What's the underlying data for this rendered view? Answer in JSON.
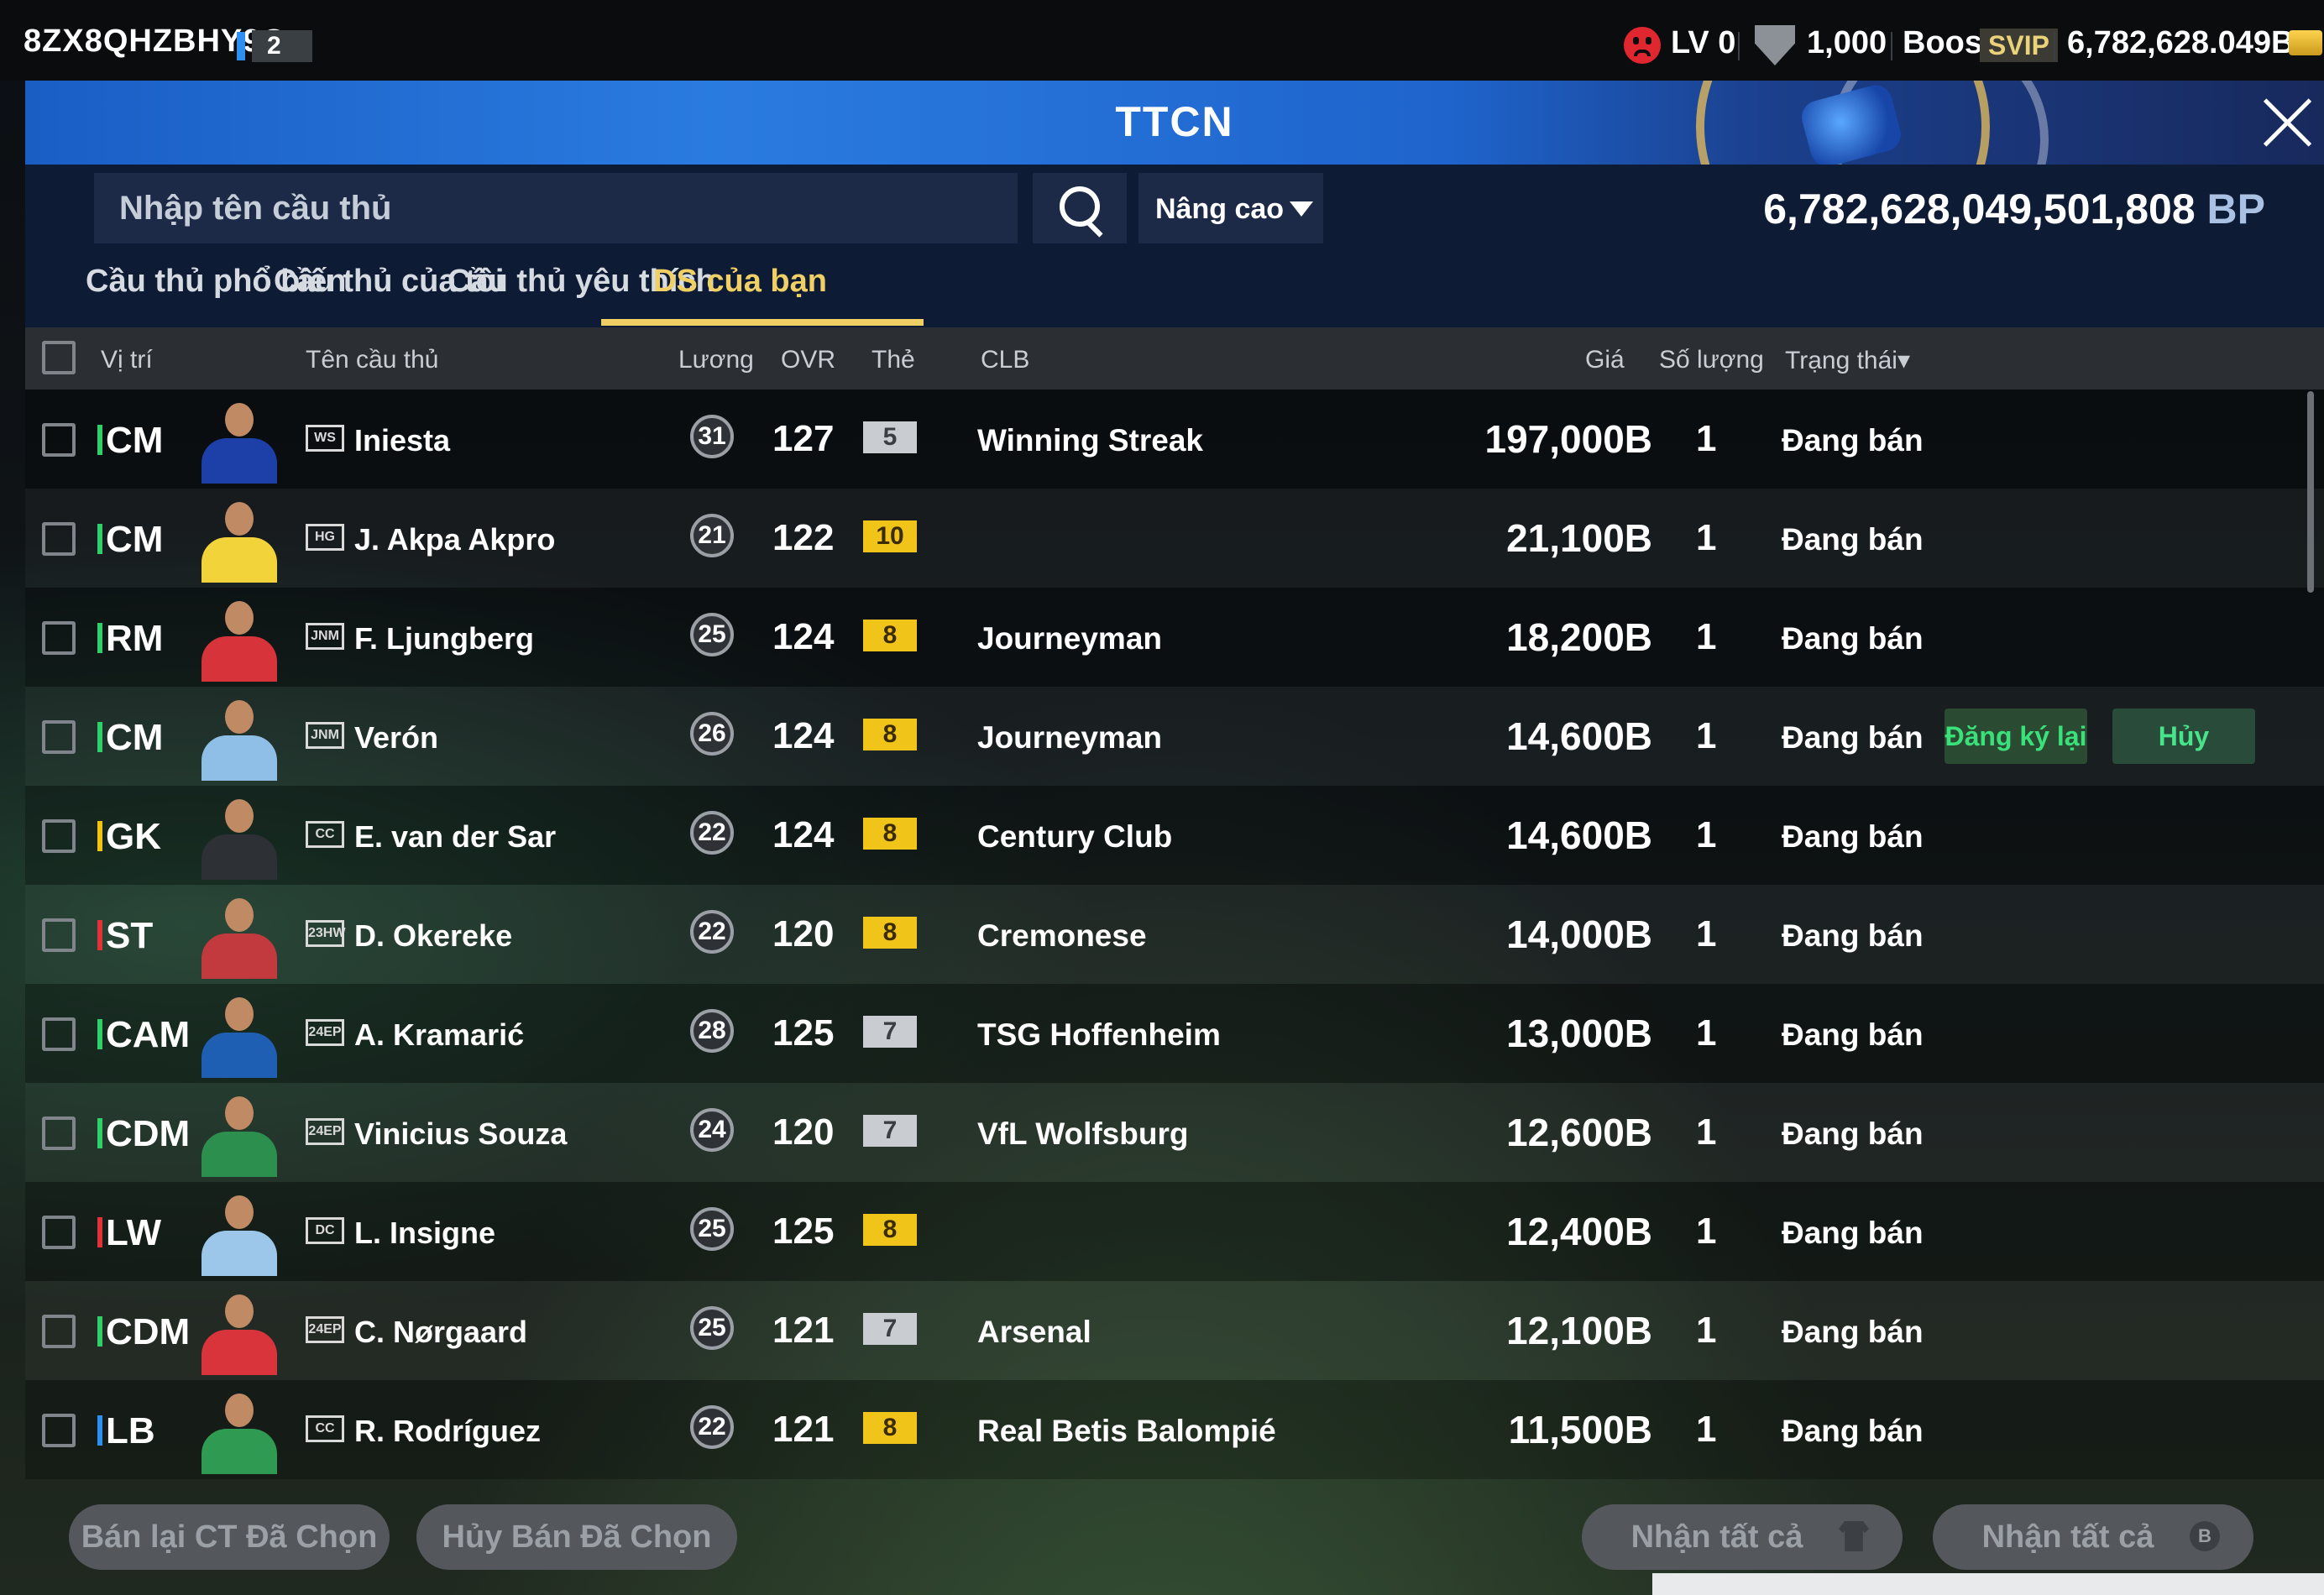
{
  "status_bar": {
    "account_id": "8ZX8QHZBHY9O",
    "account_level": "2",
    "mood_level": "LV 0",
    "shield_value": "1,000",
    "boost_label": "Boost",
    "svip_label": "SVIP",
    "coins": "6,782,628.049B",
    "mood_icon": "sad-face-icon",
    "shield_icon": "shield-icon",
    "coin_icon": "coin-icon"
  },
  "window": {
    "title": "TTCN",
    "close_icon": "close-icon"
  },
  "search": {
    "placeholder": "Nhập tên cầu thủ",
    "value": "",
    "search_icon": "search-icon",
    "advanced_label": "Nâng cao"
  },
  "balance": {
    "amount": "6,782,628,049,501,808",
    "unit": " BP"
  },
  "tabs": [
    {
      "label": "Cầu thủ phổ biến",
      "active": false
    },
    {
      "label": "Cầu thủ của tôi",
      "active": false
    },
    {
      "label": "Cầu thủ yêu thích",
      "active": false
    },
    {
      "label": "DS của bạn",
      "active": true
    }
  ],
  "columns": {
    "position": "Vị trí",
    "name": "Tên cầu thủ",
    "salary": "Lương",
    "ovr": "OVR",
    "card": "Thẻ",
    "club": "CLB",
    "price": "Giá",
    "quantity": "Số lượng",
    "status": "Trạng thái▾"
  },
  "rows": [
    {
      "position": "CM",
      "pos_color": "#2fd06a",
      "season": "WS",
      "name": "Iniesta",
      "salary": "31",
      "ovr": "127",
      "grade": "5",
      "grade_tier": "silver",
      "club": "Winning Streak",
      "price": "197,000B",
      "quantity": "1",
      "status": "Đang bán"
    },
    {
      "position": "CM",
      "pos_color": "#2fd06a",
      "season": "HG",
      "name": "J. Akpa Akpro",
      "salary": "21",
      "ovr": "122",
      "grade": "10",
      "grade_tier": "gold",
      "club": "",
      "price": "21,100B",
      "quantity": "1",
      "status": "Đang bán"
    },
    {
      "position": "RM",
      "pos_color": "#2fd06a",
      "season": "JNM",
      "name": "F. Ljungberg",
      "salary": "25",
      "ovr": "124",
      "grade": "8",
      "grade_tier": "gold",
      "club": "Journeyman",
      "price": "18,200B",
      "quantity": "1",
      "status": "Đang bán"
    },
    {
      "position": "CM",
      "pos_color": "#2fd06a",
      "season": "JNM",
      "name": "Verón",
      "salary": "26",
      "ovr": "124",
      "grade": "8",
      "grade_tier": "gold",
      "club": "Journeyman",
      "price": "14,600B",
      "quantity": "1",
      "status": "Đang bán",
      "relist_label": "Đăng ký lại",
      "cancel_label": "Hủy"
    },
    {
      "position": "GK",
      "pos_color": "#f2c40f",
      "season": "CC",
      "name": "E. van der Sar",
      "salary": "22",
      "ovr": "124",
      "grade": "8",
      "grade_tier": "gold",
      "club": "Century Club",
      "price": "14,600B",
      "quantity": "1",
      "status": "Đang bán"
    },
    {
      "position": "ST",
      "pos_color": "#e3313a",
      "season": "23HW",
      "name": "D. Okereke",
      "salary": "22",
      "ovr": "120",
      "grade": "8",
      "grade_tier": "gold",
      "club": "Cremonese",
      "price": "14,000B",
      "quantity": "1",
      "status": "Đang bán"
    },
    {
      "position": "CAM",
      "pos_color": "#2fd06a",
      "season": "24EP",
      "name": "A. Kramarić",
      "salary": "28",
      "ovr": "125",
      "grade": "7",
      "grade_tier": "silver",
      "club": "TSG Hoffenheim",
      "price": "13,000B",
      "quantity": "1",
      "status": "Đang bán"
    },
    {
      "position": "CDM",
      "pos_color": "#2fd06a",
      "season": "24EP",
      "name": "Vinicius Souza",
      "salary": "24",
      "ovr": "120",
      "grade": "7",
      "grade_tier": "silver",
      "club": "VfL Wolfsburg",
      "price": "12,600B",
      "quantity": "1",
      "status": "Đang bán"
    },
    {
      "position": "LW",
      "pos_color": "#e3313a",
      "season": "DC",
      "name": "L. Insigne",
      "salary": "25",
      "ovr": "125",
      "grade": "8",
      "grade_tier": "gold",
      "club": "",
      "price": "12,400B",
      "quantity": "1",
      "status": "Đang bán"
    },
    {
      "position": "CDM",
      "pos_color": "#2fd06a",
      "season": "24EP",
      "name": "C. Nørgaard",
      "salary": "25",
      "ovr": "121",
      "grade": "7",
      "grade_tier": "silver",
      "club": "Arsenal",
      "price": "12,100B",
      "quantity": "1",
      "status": "Đang bán"
    },
    {
      "position": "LB",
      "pos_color": "#2f8ff0",
      "season": "CC",
      "name": "R. Rodríguez",
      "salary": "22",
      "ovr": "121",
      "grade": "8",
      "grade_tier": "gold",
      "club": "Real Betis Balompié",
      "price": "11,500B",
      "quantity": "1",
      "status": "Đang bán"
    }
  ],
  "footer": {
    "resell_selected": "Bán lại CT Đã Chọn",
    "cancel_selected": "Hủy Bán Đã Chọn",
    "claim_all_players": "Nhận tất cả",
    "claim_all_bp": "Nhận tất cả",
    "claim_players_icon": "shirt-icon",
    "claim_bp_icon": "bp-coin-icon"
  }
}
